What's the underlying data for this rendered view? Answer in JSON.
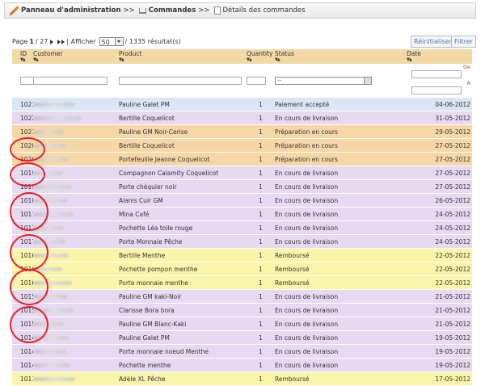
{
  "breadcrumb": {
    "item1": "Panneau d'administration",
    "sep": ">>",
    "item2": "Commandes",
    "item3": "Détails des commandes"
  },
  "pager": {
    "prefix": "Page",
    "page": "1",
    "of": "/ 27",
    "show_label": "| Afficher",
    "per_page": "50",
    "results": "/ 1335 résultat(s)"
  },
  "buttons": {
    "reset": "Réinitialiser",
    "filter": "Filtrer"
  },
  "columns": {
    "id": "ID",
    "customer": "Customer",
    "product": "Product",
    "quantity": "Quantity",
    "status": "Status",
    "date": "Date"
  },
  "filters": {
    "status_value": "--",
    "date_from": "De",
    "date_to": "A"
  },
  "row_colors": {
    "blue": "#d9e6f5",
    "orange": "#f8d7a6",
    "purple": "#e6d9f2",
    "yellow": "#fbf5aa"
  },
  "rows": [
    {
      "id": "1023",
      "product": "Pauline Galet PM",
      "quantity": "1",
      "status": "Paiement accepté",
      "date": "04-06-2012",
      "color": "#d9e6f5"
    },
    {
      "id": "1022",
      "product": "Bertille Coquelicot",
      "quantity": "1",
      "status": "En cours de livraison",
      "date": "31-05-2012",
      "color": "#e6d9f2"
    },
    {
      "id": "1021",
      "product": "Pauline GM Noir-Cerise",
      "quantity": "1",
      "status": "Préparation en cours",
      "date": "29-05-2012",
      "color": "#f8d7a6"
    },
    {
      "id": "1020",
      "product": "Bertille Coquelicot",
      "quantity": "1",
      "status": "Préparation en cours",
      "date": "27-05-2012",
      "color": "#f8d7a6"
    },
    {
      "id": "1020",
      "product": "Portefeuille Jeanne Coquelicot",
      "quantity": "1",
      "status": "Préparation en cours",
      "date": "27-05-2012",
      "color": "#f8d7a6"
    },
    {
      "id": "1019",
      "product": "Compagnon Calamity Coquelicot",
      "quantity": "1",
      "status": "En cours de livraison",
      "date": "27-05-2012",
      "color": "#e6d9f2"
    },
    {
      "id": "1019",
      "product": "Porte chéquier noir",
      "quantity": "1",
      "status": "En cours de livraison",
      "date": "27-05-2012",
      "color": "#e6d9f2"
    },
    {
      "id": "1018",
      "product": "Alanis Cuir GM",
      "quantity": "1",
      "status": "En cours de livraison",
      "date": "26-05-2012",
      "color": "#e6d9f2"
    },
    {
      "id": "1017",
      "product": "Mina Café",
      "quantity": "1",
      "status": "En cours de livraison",
      "date": "24-05-2012",
      "color": "#e6d9f2"
    },
    {
      "id": "1017",
      "product": "Pochette Léa toile rouge",
      "quantity": "1",
      "status": "En cours de livraison",
      "date": "24-05-2012",
      "color": "#e6d9f2"
    },
    {
      "id": "1017",
      "product": "Porte Monnaie Pêche",
      "quantity": "1",
      "status": "En cours de livraison",
      "date": "24-05-2012",
      "color": "#e6d9f2"
    },
    {
      "id": "1016",
      "product": "Bertille Menthe",
      "quantity": "1",
      "status": "Remboursé",
      "date": "22-05-2012",
      "color": "#fbf5aa"
    },
    {
      "id": "1016",
      "product": "Pochette pompon menthe",
      "quantity": "1",
      "status": "Remboursé",
      "date": "22-05-2012",
      "color": "#fbf5aa"
    },
    {
      "id": "1016",
      "product": "Porte monnaie menthe",
      "quantity": "1",
      "status": "Remboursé",
      "date": "22-05-2012",
      "color": "#fbf5aa"
    },
    {
      "id": "1015",
      "product": "Pauline GM kaki-Noir",
      "quantity": "1",
      "status": "En cours de livraison",
      "date": "21-05-2012",
      "color": "#e6d9f2"
    },
    {
      "id": "1015",
      "product": "Clarisse Bora bora",
      "quantity": "1",
      "status": "En cours de livraison",
      "date": "21-05-2012",
      "color": "#e6d9f2"
    },
    {
      "id": "1015",
      "product": "Pauline GM Blanc-Kaki",
      "quantity": "1",
      "status": "En cours de livraison",
      "date": "21-05-2012",
      "color": "#e6d9f2"
    },
    {
      "id": "1014",
      "product": "Pauline Galet PM",
      "quantity": "1",
      "status": "En cours de livraison",
      "date": "19-05-2012",
      "color": "#e6d9f2"
    },
    {
      "id": "1014",
      "product": "Porte monnaie noeud Menthe",
      "quantity": "1",
      "status": "En cours de livraison",
      "date": "19-05-2012",
      "color": "#e6d9f2"
    },
    {
      "id": "1014",
      "product": "Pochette menthe",
      "quantity": "1",
      "status": "En cours de livraison",
      "date": "19-05-2012",
      "color": "#e6d9f2"
    },
    {
      "id": "1013",
      "product": "Adèle XL Pêche",
      "quantity": "1",
      "status": "Remboursé",
      "date": "17-05-2012",
      "color": "#fbf5aa"
    }
  ]
}
